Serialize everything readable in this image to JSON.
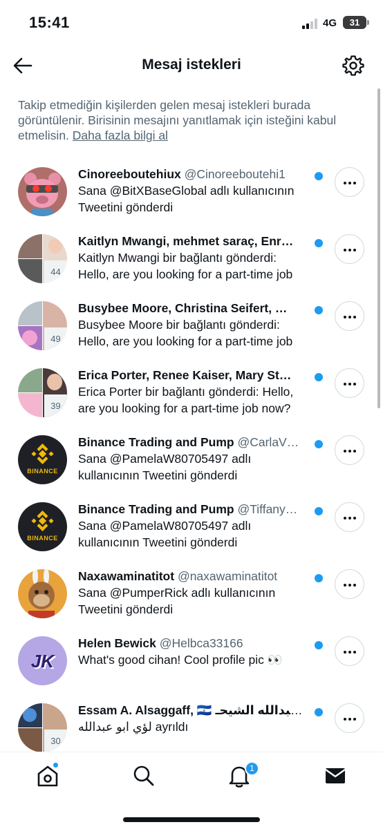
{
  "status_bar": {
    "time": "15:41",
    "network": "4G",
    "battery": "31"
  },
  "header": {
    "title": "Mesaj istekleri",
    "back_icon": "arrow-left-icon",
    "settings_icon": "gear-icon"
  },
  "info": {
    "text": "Takip etmediğin kişilerden gelen mesaj istekleri burada görüntülenir. Birisinin mesajını yanıtlamak için isteğini kabul etmelisin.",
    "link": "Daha fazla bilgi al"
  },
  "colors": {
    "accent": "#1d9bf0",
    "text": "#0f1419",
    "secondary": "#536471",
    "border": "#cfd9de"
  },
  "requests": [
    {
      "name": "Cinoreeboutehiux",
      "handle": "@Cinoreeboutehi1",
      "preview": "Sana @BitXBaseGlobal adlı kullanıcının Tweetini gönderdi",
      "avatar": "pink-bear-avatar",
      "group_count": "",
      "unread": true
    },
    {
      "name": "Kaitlyn Mwangi, mehmet saraç, Enr…",
      "handle": "",
      "preview": "Kaitlyn Mwangi bir bağlantı gönderdi: Hello, are you looking for a part-time job",
      "avatar": "group-avatar",
      "group_count": "44",
      "unread": true
    },
    {
      "name": "Busybee Moore, Christina Seifert, …",
      "handle": "",
      "preview": "Busybee Moore bir bağlantı gönderdi: Hello, are you looking for a part-time job",
      "avatar": "group-avatar",
      "group_count": "49",
      "unread": true
    },
    {
      "name": "Erica Porter, Renee Kaiser, Mary St…",
      "handle": "",
      "preview": "Erica Porter bir bağlantı gönderdi: Hello, are you looking for a part-time job now?",
      "avatar": "group-avatar",
      "group_count": "39",
      "unread": true
    },
    {
      "name": "Binance Trading and Pump",
      "handle": "@CarlaV…",
      "preview": "Sana @PamelaW80705497 adlı kullanıcının Tweetini gönderdi",
      "avatar": "binance-avatar",
      "avatar_text": "BINANCE",
      "group_count": "",
      "unread": true
    },
    {
      "name": "Binance Trading and Pump",
      "handle": "@Tiffany…",
      "preview": "Sana @PamelaW80705497 adlı kullanıcının Tweetini gönderdi",
      "avatar": "binance-avatar",
      "avatar_text": "BINANCE",
      "group_count": "",
      "unread": true
    },
    {
      "name": "Naxawaminatitot",
      "handle": "@naxawaminatitot",
      "preview": "Sana @PumperRick adlı kullanıcının Tweetini gönderdi",
      "avatar": "ape-avatar",
      "group_count": "",
      "unread": true
    },
    {
      "name": "Helen Bewick",
      "handle": "@Helbca33166",
      "preview": "What's good cihan! Cool profile pic 👀",
      "avatar": "jk-logo-avatar",
      "avatar_text": "JK",
      "group_count": "",
      "unread": true
    },
    {
      "name": "Essam A. Alsaggaff, 🇸🇻 عبدالله الشيحـ…",
      "handle": "",
      "preview": "لؤي ابو عبدالله ayrıldı",
      "avatar": "group-avatar",
      "group_count": "30",
      "unread": true
    }
  ],
  "bottom_nav": {
    "items": [
      "home-icon",
      "search-icon",
      "bell-icon",
      "mail-icon"
    ],
    "notification_badge": "1"
  }
}
